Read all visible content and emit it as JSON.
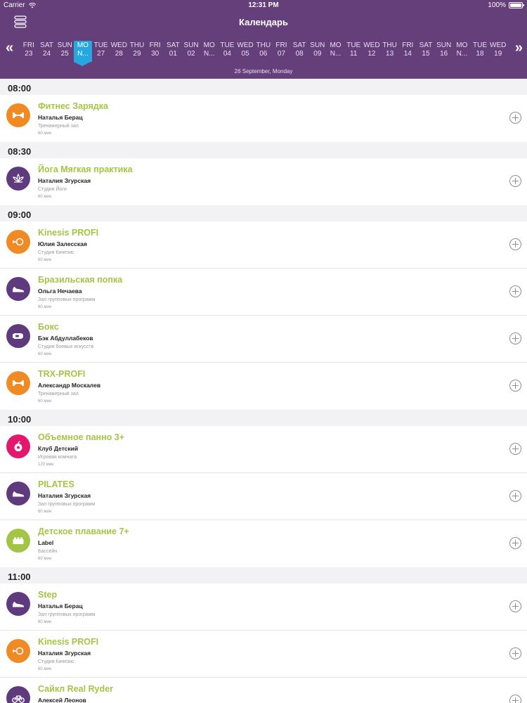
{
  "statusbar": {
    "carrier": "Carrier",
    "time": "12:31 PM",
    "battery": "100%"
  },
  "header": {
    "title": "Календарь",
    "current_date": "26 September, Monday",
    "prev_glyph": "«",
    "next_glyph": "»"
  },
  "days": [
    {
      "name": "FRI",
      "date": "23"
    },
    {
      "name": "SAT",
      "date": "24"
    },
    {
      "name": "SUN",
      "date": "25"
    },
    {
      "name": "MO",
      "date": "N...",
      "selected": true
    },
    {
      "name": "TUE",
      "date": "27"
    },
    {
      "name": "WED",
      "date": "28"
    },
    {
      "name": "THU",
      "date": "29"
    },
    {
      "name": "FRI",
      "date": "30"
    },
    {
      "name": "SAT",
      "date": "01"
    },
    {
      "name": "SUN",
      "date": "02"
    },
    {
      "name": "MO",
      "date": "N..."
    },
    {
      "name": "TUE",
      "date": "04"
    },
    {
      "name": "WED",
      "date": "05"
    },
    {
      "name": "THU",
      "date": "06"
    },
    {
      "name": "FRI",
      "date": "07"
    },
    {
      "name": "SAT",
      "date": "08"
    },
    {
      "name": "SUN",
      "date": "09"
    },
    {
      "name": "MO",
      "date": "N..."
    },
    {
      "name": "TUE",
      "date": "11"
    },
    {
      "name": "WED",
      "date": "12"
    },
    {
      "name": "THU",
      "date": "13"
    },
    {
      "name": "FRI",
      "date": "14"
    },
    {
      "name": "SAT",
      "date": "15"
    },
    {
      "name": "SUN",
      "date": "16"
    },
    {
      "name": "MO",
      "date": "N..."
    },
    {
      "name": "TUE",
      "date": "18"
    },
    {
      "name": "WED",
      "date": "19"
    }
  ],
  "colors": {
    "header": "#653f7a",
    "selected_day": "#25a8e0",
    "title_green": "#a3c545",
    "orange": "#f08a24",
    "purple": "#5f3a7c",
    "pink": "#e3176e",
    "lime": "#a3c545"
  },
  "schedule": [
    {
      "time": "08:00",
      "events": [
        {
          "title": "Фитнес Зарядка",
          "trainer": "Наталья Берац",
          "room": "Тренажерный зал",
          "duration": "60 мин",
          "icon": "dumbbell-icon",
          "color": "#f08a24"
        }
      ]
    },
    {
      "time": "08:30",
      "events": [
        {
          "title": "Йога Мягкая практика",
          "trainer": "Наталия Згурская",
          "room": "Студия Йоги",
          "duration": "60 мин",
          "icon": "lotus-icon",
          "color": "#5f3a7c"
        }
      ]
    },
    {
      "time": "09:00",
      "events": [
        {
          "title": "Kinesis PROFI",
          "trainer": "Юлия Залесская",
          "room": "Студия Кинезис",
          "duration": "60 мин",
          "icon": "kinesis-icon",
          "color": "#f08a24"
        },
        {
          "title": "Бразильская попка",
          "trainer": "Ольга Нечаева",
          "room": "Зал групповых программ",
          "duration": "60 мин",
          "icon": "sneaker-icon",
          "color": "#5f3a7c"
        },
        {
          "title": "Бокс",
          "trainer": "Бэк Абдуллабеков",
          "room": "Студия боевых искусств",
          "duration": "60 мин",
          "icon": "boxing-glove-icon",
          "color": "#5f3a7c"
        },
        {
          "title": "TRX-PROFI",
          "trainer": "Александр Москалев",
          "room": "Тренажерный зал",
          "duration": "60 мин",
          "icon": "dumbbell-icon",
          "color": "#f08a24"
        }
      ]
    },
    {
      "time": "10:00",
      "events": [
        {
          "title": "Объемное панно 3+",
          "trainer": "Клуб Детский",
          "room": "Игровая комната",
          "duration": "120 мин",
          "icon": "apple-icon",
          "color": "#e3176e"
        },
        {
          "title": "PILATES",
          "trainer": "Наталия Згурская",
          "room": "Зал групповых программ",
          "duration": "60 мин",
          "icon": "sneaker-icon",
          "color": "#5f3a7c"
        },
        {
          "title": "Детское плавание 7+",
          "trainer": "Label",
          "room": "Бассейн",
          "duration": "60 мин",
          "icon": "building-block-icon",
          "color": "#a3c545"
        }
      ]
    },
    {
      "time": "11:00",
      "events": [
        {
          "title": "Step",
          "trainer": "Наталья Берац",
          "room": "Зал групповых программ",
          "duration": "60 мин",
          "icon": "sneaker-icon",
          "color": "#5f3a7c"
        },
        {
          "title": "Kinesis PROFI",
          "trainer": "Наталия Згурская",
          "room": "Студия Кинезис",
          "duration": "60 мин",
          "icon": "kinesis-icon",
          "color": "#f08a24"
        },
        {
          "title": "Сайкл Real Ryder",
          "trainer": "Алексей Леонов",
          "room": "",
          "duration": "",
          "icon": "bicycle-icon",
          "color": "#5f3a7c"
        }
      ]
    }
  ]
}
